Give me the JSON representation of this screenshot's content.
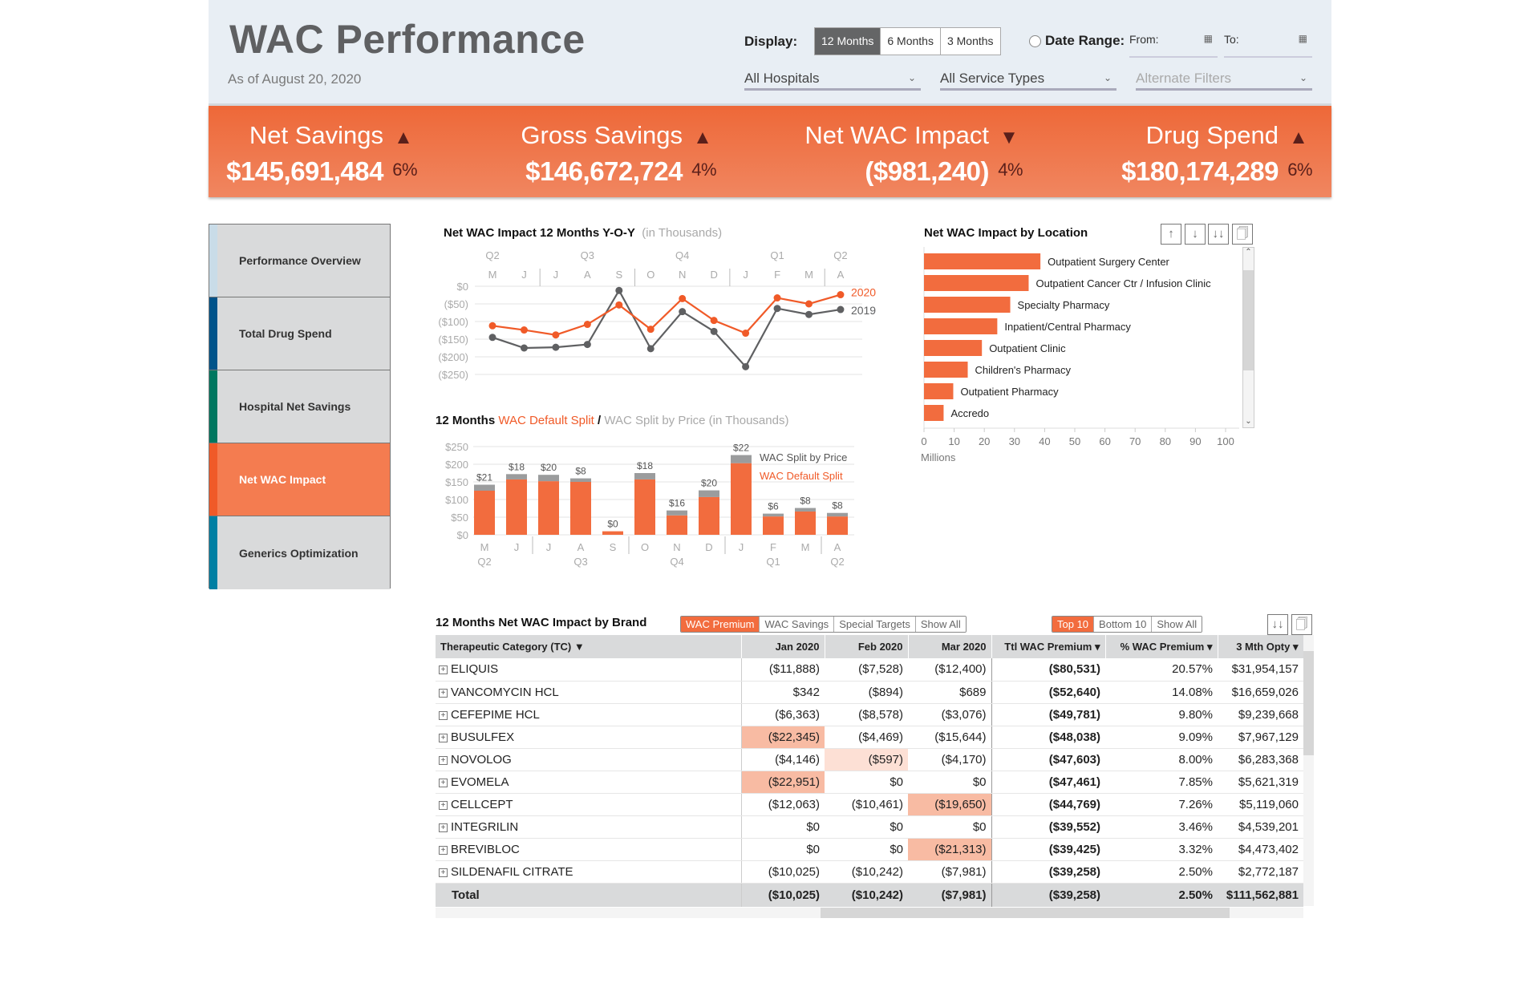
{
  "header": {
    "title": "WAC Performance",
    "subtitle": "As of August 20, 2020",
    "display_label": "Display:",
    "display_options": [
      "12 Months",
      "6 Months",
      "3 Months"
    ],
    "display_selected": "12 Months",
    "date_range_label": "Date Range:",
    "from_label": "From:",
    "to_label": "To:",
    "filters": [
      "All Hospitals",
      "All Service Types",
      "Alternate Filters"
    ]
  },
  "kpis": [
    {
      "title": "Net Savings",
      "value": "$145,691,484",
      "pct": "6%",
      "trend": "up"
    },
    {
      "title": "Gross Savings",
      "value": "$146,672,724",
      "pct": "4%",
      "trend": "up"
    },
    {
      "title": "Net WAC Impact",
      "value": "($981,240)",
      "pct": "4%",
      "trend": "down"
    },
    {
      "title": "Drug Spend",
      "value": "$180,174,289",
      "pct": "6%",
      "trend": "up"
    }
  ],
  "colors": {
    "accent": "#f26c3e",
    "trend_arrow": "#5a1f1a",
    "series_2019": "#5f6062",
    "split_by_price": "#9b9c9d",
    "highlight_strong": "#f8bba3",
    "highlight_light": "#fde0d5"
  },
  "sidebar": {
    "items": [
      {
        "label": "Performance Overview",
        "color": "#c9dce8",
        "active": false
      },
      {
        "label": "Total Drug Spend",
        "color": "#00538a",
        "active": false
      },
      {
        "label": "Hospital Net Savings",
        "color": "#00775f",
        "active": false
      },
      {
        "label": "Net WAC Impact",
        "color": "#f05a28",
        "active": true
      },
      {
        "label": "Generics Optimization",
        "color": "#007fa3",
        "active": false
      }
    ]
  },
  "chart_data": [
    {
      "type": "line",
      "title": "Net WAC Impact 12 Months Y-O-Y",
      "title_note": "(in Thousands)",
      "x": [
        "M",
        "J",
        "J",
        "A",
        "S",
        "O",
        "N",
        "D",
        "J",
        "F",
        "M",
        "A"
      ],
      "quarters": [
        "Q2",
        "Q3",
        "Q4",
        "Q1",
        "Q2"
      ],
      "yticks": [
        "$0",
        "($50)",
        "($100)",
        "($150)",
        "($200)",
        "($250)"
      ],
      "ylim": [
        -250,
        0
      ],
      "grid": true,
      "legend": "right",
      "series": [
        {
          "name": "2020",
          "color": "#f05a28",
          "values": [
            -112,
            -124,
            -138,
            -108,
            -53,
            -122,
            -35,
            -97,
            -133,
            -33,
            -50,
            -24
          ]
        },
        {
          "name": "2019",
          "color": "#5f6062",
          "values": [
            -145,
            -175,
            -173,
            -165,
            -12,
            -177,
            -72,
            -128,
            -228,
            -63,
            -80,
            -66
          ]
        }
      ]
    },
    {
      "type": "bar",
      "stacked": true,
      "title_prefix": "12 Months",
      "title_series_a": "WAC Default Split",
      "title_sep": "/",
      "title_series_b": "WAC Split by Price",
      "title_note": "(in Thousands)",
      "categories": [
        "M",
        "J",
        "J",
        "A",
        "S",
        "O",
        "N",
        "D",
        "J",
        "F",
        "M",
        "A"
      ],
      "quarters": [
        "Q2",
        "Q3",
        "Q4",
        "Q1",
        "Q2"
      ],
      "yticks": [
        "$250",
        "$200",
        "$150",
        "$100",
        "$50",
        "$0"
      ],
      "ylim": [
        0,
        250
      ],
      "grid": true,
      "legend": "top-right",
      "series": [
        {
          "name": "WAC Default Split",
          "color": "#f26c3e",
          "values": [
            125,
            157,
            152,
            150,
            10,
            157,
            55,
            107,
            203,
            52,
            66,
            52
          ]
        },
        {
          "name": "WAC Split by Price",
          "color": "#9b9c9d",
          "values": [
            17,
            15,
            18,
            10,
            0,
            18,
            14,
            19,
            23,
            8,
            10,
            10
          ]
        }
      ],
      "data_labels": [
        "$21",
        "$18",
        "$20",
        "$8",
        "$0",
        "$18",
        "$16",
        "$20",
        "$22",
        "$6",
        "$8",
        "$8"
      ]
    },
    {
      "type": "bar",
      "orientation": "horizontal",
      "title": "Net WAC Impact by Location",
      "categories": [
        "Outpatient Surgery Center",
        "Outpatient Cancer Ctr / Infusion Clinic",
        "Specialty Pharmacy",
        "Inpatient/Central Pharmacy",
        "Outpatient Clinic",
        "Children's Pharmacy",
        "Outpatient Pharmacy",
        "Accredo"
      ],
      "values": [
        38.6,
        34.7,
        28.6,
        24.3,
        19.2,
        14.5,
        9.7,
        6.5
      ],
      "xticks": [
        "0",
        "10",
        "20",
        "30",
        "40",
        "50",
        "60",
        "70",
        "80",
        "90",
        "100"
      ],
      "xlim": [
        0,
        100
      ],
      "xlabel": "Millions",
      "color": "#f26c3e"
    }
  ],
  "location_tools": [
    "sort-ascending-icon",
    "sort-descending-icon",
    "sort-icon",
    "export-icon"
  ],
  "brand_table": {
    "title": "12 Months Net WAC Impact by Brand",
    "filter_buttons": [
      "WAC Premium",
      "WAC Savings",
      "Special Targets",
      "Show All"
    ],
    "filter_selected": "WAC Premium",
    "rank_buttons": [
      "Top 10",
      "Bottom 10",
      "Show All"
    ],
    "rank_selected": "Top 10",
    "columns": [
      "Therapeutic Category (TC) ▼",
      "Jan 2020",
      "Feb 2020",
      "Mar 2020",
      "Ttl WAC Premium ▾",
      "% WAC Premium ▾",
      "3 Mth Opty ▾"
    ],
    "rows": [
      {
        "name": "ELIQUIS",
        "cells": [
          "($11,888)",
          "($7,528)",
          "($12,400)",
          "($80,531)",
          "20.57%",
          "$31,954,157"
        ],
        "hl": [
          "",
          "",
          ""
        ]
      },
      {
        "name": "VANCOMYCIN HCL",
        "cells": [
          "$342",
          "($894)",
          "$689",
          "($52,640)",
          "14.08%",
          "$16,659,026"
        ],
        "hl": [
          "",
          "",
          ""
        ]
      },
      {
        "name": "CEFEPIME HCL",
        "cells": [
          "($6,363)",
          "($8,578)",
          "($3,076)",
          "($49,781)",
          "9.80%",
          "$9,239,668"
        ],
        "hl": [
          "",
          "",
          ""
        ]
      },
      {
        "name": "BUSULFEX",
        "cells": [
          "($22,345)",
          "($4,469)",
          "($15,644)",
          "($48,038)",
          "9.09%",
          "$7,967,129"
        ],
        "hl": [
          "strong",
          "",
          ""
        ]
      },
      {
        "name": "NOVOLOG",
        "cells": [
          "($4,146)",
          "($597)",
          "($4,170)",
          "($47,603)",
          "8.00%",
          "$6,283,368"
        ],
        "hl": [
          "",
          "light",
          ""
        ]
      },
      {
        "name": "EVOMELA",
        "cells": [
          "($22,951)",
          "$0",
          "$0",
          "($47,461)",
          "7.85%",
          "$5,621,319"
        ],
        "hl": [
          "strong",
          "",
          ""
        ]
      },
      {
        "name": "CELLCEPT",
        "cells": [
          "($12,063)",
          "($10,461)",
          "($19,650)",
          "($44,769)",
          "7.26%",
          "$5,119,060"
        ],
        "hl": [
          "",
          "",
          "strong"
        ]
      },
      {
        "name": "INTEGRILIN",
        "cells": [
          "$0",
          "$0",
          "$0",
          "($39,552)",
          "3.46%",
          "$4,539,201"
        ],
        "hl": [
          "",
          "",
          ""
        ]
      },
      {
        "name": "BREVIBLOC",
        "cells": [
          "$0",
          "$0",
          "($21,313)",
          "($39,425)",
          "3.32%",
          "$4,473,402"
        ],
        "hl": [
          "",
          "",
          "strong"
        ]
      },
      {
        "name": "SILDENAFIL CITRATE",
        "cells": [
          "($10,025)",
          "($10,242)",
          "($7,981)",
          "($39,258)",
          "2.50%",
          "$2,772,187"
        ],
        "hl": [
          "",
          "",
          ""
        ]
      }
    ],
    "total": {
      "name": "Total",
      "cells": [
        "($10,025)",
        "($10,242)",
        "($7,981)",
        "($39,258)",
        "2.50%",
        "$111,562,881"
      ]
    }
  }
}
